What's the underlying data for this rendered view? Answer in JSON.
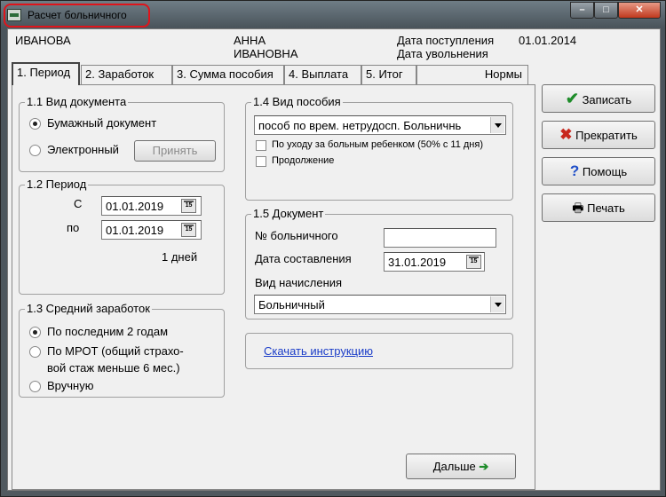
{
  "window": {
    "title": "Расчет больничного"
  },
  "header": {
    "surname": "ИВАНОВА",
    "name": "АННА",
    "patronymic": "ИВАНОВНА",
    "hire_label": "Дата поступления",
    "hire_date": "01.01.2014",
    "dismiss_label": "Дата увольнения"
  },
  "tabs": [
    {
      "label": "1. Период"
    },
    {
      "label": "2. Заработок"
    },
    {
      "label": "3. Сумма пособия"
    },
    {
      "label": "4. Выплата"
    },
    {
      "label": "5. Итог"
    },
    {
      "label": "Нормы"
    }
  ],
  "doc_type": {
    "title": "1.1 Вид документа",
    "paper": "Бумажный документ",
    "electronic": "Электронный",
    "accept_button": "Принять",
    "selected": "paper"
  },
  "period": {
    "title": "1.2 Период",
    "from_label": "С",
    "to_label": "по",
    "from_date": "01.01.2019",
    "to_date": "01.01.2019",
    "days": "1 дней",
    "cal_icon": "15"
  },
  "avg_earnings": {
    "title": "1.3 Средний заработок",
    "opt1": "По последним 2 годам",
    "opt2_line1": "По МРОТ (общий страхо-",
    "opt2_line2": "вой стаж меньше 6 мес.)",
    "opt3": "Вручную",
    "selected": "opt1"
  },
  "benefit": {
    "title": "1.4 Вид пособия",
    "selected_value": "пособ по врем. нетрудосп. Больничнь",
    "child_care": "По уходу за больным ребенком (50% с 11 дня)",
    "continuation": "Продолжение"
  },
  "document": {
    "title": "1.5 Документ",
    "number_label": "№ больничного",
    "number_value": "",
    "date_label": "Дата составления",
    "date_value": "31.01.2019",
    "accrual_label": "Вид начисления",
    "accrual_value": "Больничный",
    "cal_icon": "15"
  },
  "download_link": "Скачать инструкцию",
  "next_button": "Дальше",
  "actions": {
    "save": "Записать",
    "stop": "Прекратить",
    "help": "Помощь",
    "print": "Печать"
  },
  "colors": {
    "accent_green": "#1e8c2a",
    "stop_red": "#c8281e",
    "help_blue": "#1e4ec8",
    "link": "#1a3cc8",
    "highlight": "#e0141b"
  }
}
